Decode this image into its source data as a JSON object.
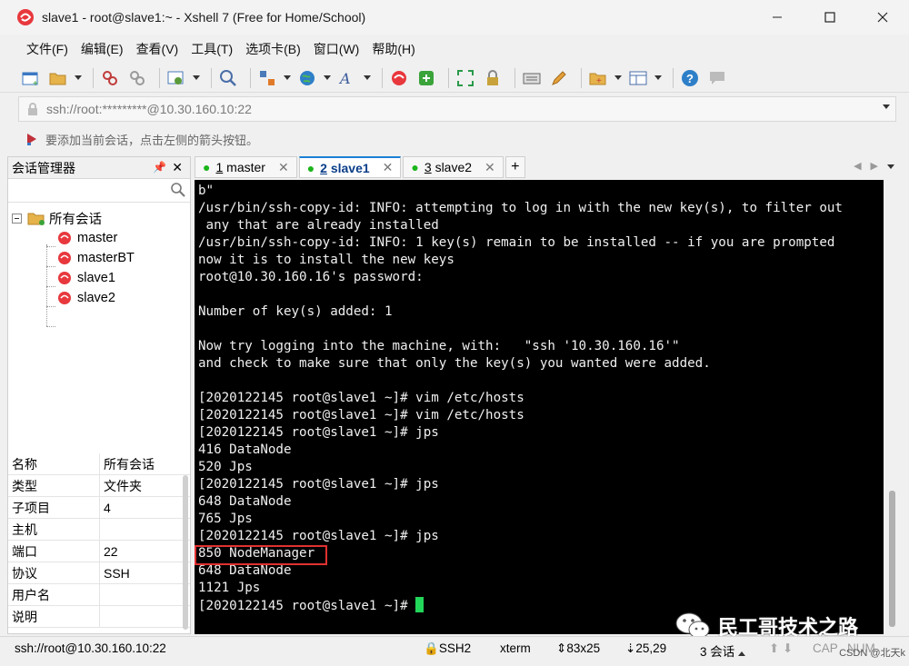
{
  "window": {
    "title": "slave1 - root@slave1:~ - Xshell 7 (Free for Home/School)"
  },
  "menu": [
    "文件(F)",
    "编辑(E)",
    "查看(V)",
    "工具(T)",
    "选项卡(B)",
    "窗口(W)",
    "帮助(H)"
  ],
  "address": {
    "value": "ssh://root:*********@10.30.160.10:22"
  },
  "hint": "要添加当前会话，点击左侧的箭头按钮。",
  "session_manager": {
    "title": "会话管理器",
    "root": "所有会话",
    "sessions": [
      "master",
      "masterBT",
      "slave1",
      "slave2"
    ],
    "properties": [
      {
        "key": "名称",
        "value": "所有会话"
      },
      {
        "key": "类型",
        "value": "文件夹"
      },
      {
        "key": "子项目",
        "value": "4"
      },
      {
        "key": "主机",
        "value": ""
      },
      {
        "key": "端口",
        "value": "22"
      },
      {
        "key": "协议",
        "value": "SSH"
      },
      {
        "key": "用户名",
        "value": ""
      },
      {
        "key": "说明",
        "value": ""
      }
    ]
  },
  "tabs": [
    {
      "num": "1",
      "label": "master",
      "active": false
    },
    {
      "num": "2",
      "label": "slave1",
      "active": true
    },
    {
      "num": "3",
      "label": "slave2",
      "active": false
    }
  ],
  "terminal": {
    "lines": [
      "b\"",
      "/usr/bin/ssh-copy-id: INFO: attempting to log in with the new key(s), to filter out",
      " any that are already installed",
      "/usr/bin/ssh-copy-id: INFO: 1 key(s) remain to be installed -- if you are prompted",
      "now it is to install the new keys",
      "root@10.30.160.16's password:",
      "",
      "Number of key(s) added: 1",
      "",
      "Now try logging into the machine, with:   \"ssh '10.30.160.16'\"",
      "and check to make sure that only the key(s) you wanted were added.",
      "",
      "[2020122145 root@slave1 ~]# vim /etc/hosts",
      "[2020122145 root@slave1 ~]# vim /etc/hosts",
      "[2020122145 root@slave1 ~]# jps",
      "416 DataNode",
      "520 Jps",
      "[2020122145 root@slave1 ~]# jps",
      "648 DataNode",
      "765 Jps",
      "[2020122145 root@slave1 ~]# jps",
      "850 NodeManager",
      "648 DataNode",
      "1121 Jps"
    ],
    "prompt": "[2020122145 root@slave1 ~]# "
  },
  "watermark": {
    "text": "民工哥技术之路",
    "sub": "CSDN @北天k"
  },
  "status": {
    "address": "ssh://root@10.30.160.10:22",
    "protocol": "SSH2",
    "term": "xterm",
    "size": "83x25",
    "pos": "25,29",
    "sessions": "3 会话",
    "caps": "CAP",
    "num": "NUM"
  }
}
